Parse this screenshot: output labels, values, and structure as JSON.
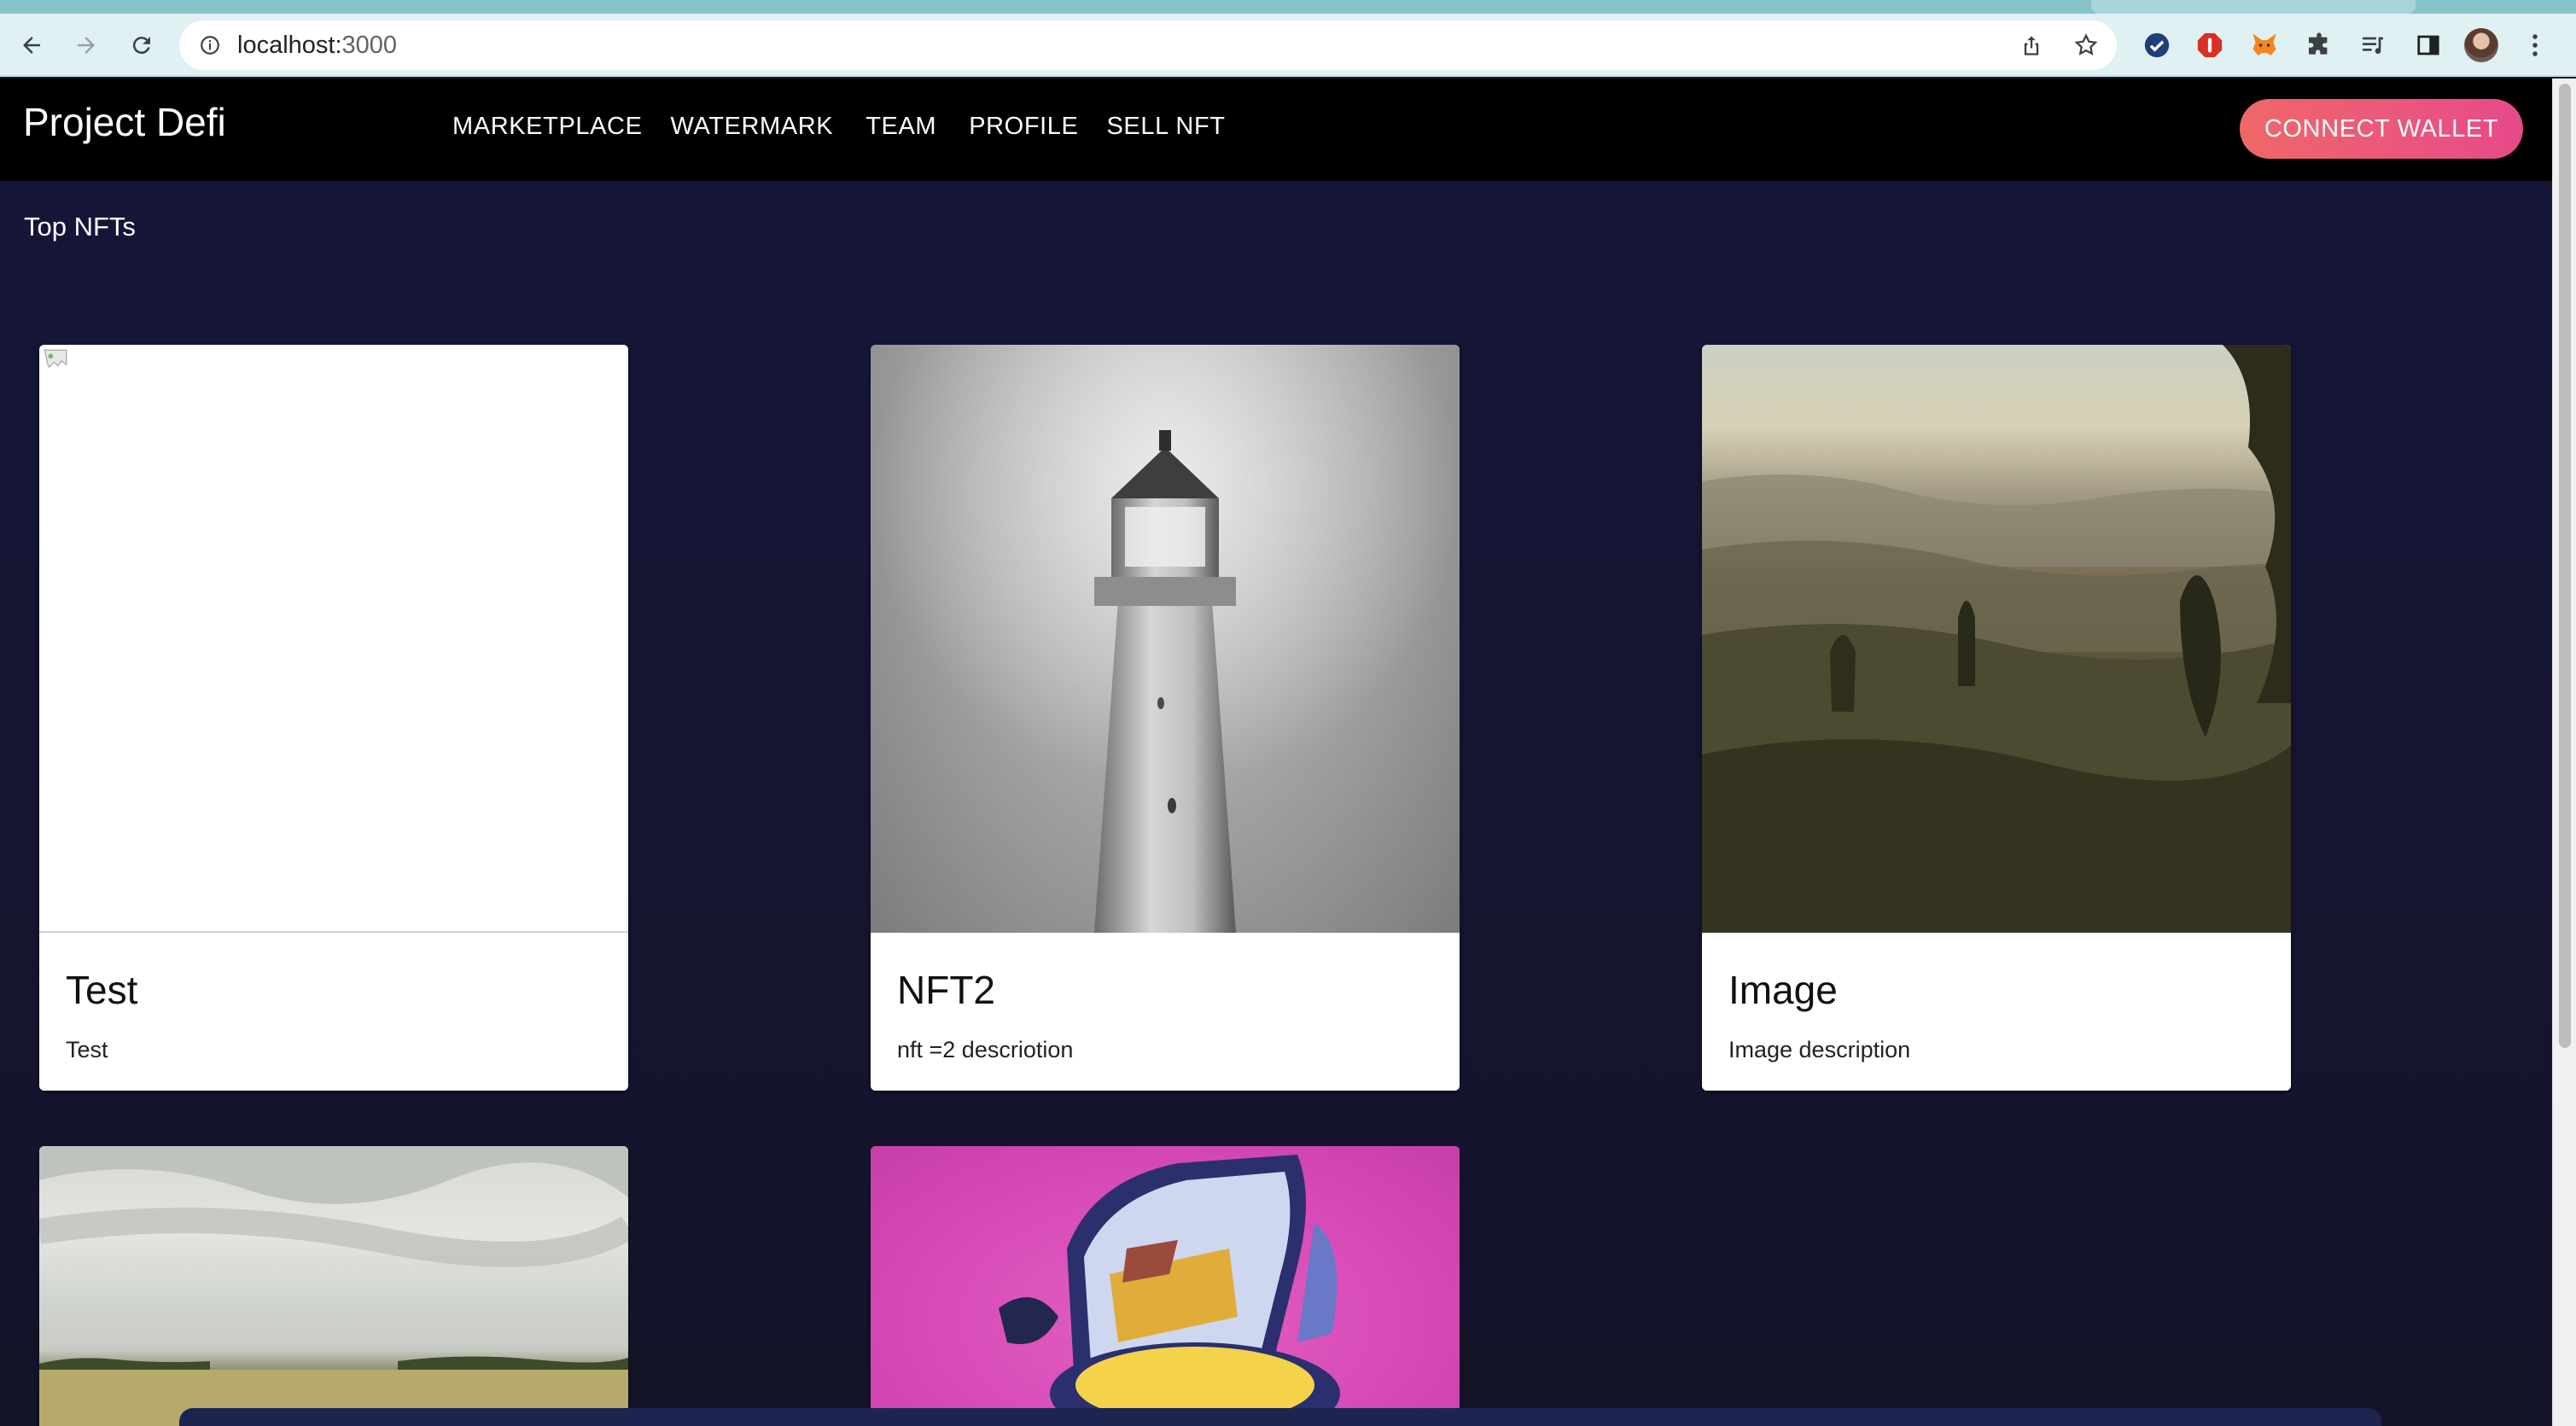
{
  "browser": {
    "url_host": "localhost:",
    "url_port": "3000",
    "icons": [
      "back-arrow-icon",
      "forward-arrow-icon",
      "reload-icon",
      "site-info-icon",
      "share-icon",
      "bookmark-star-icon",
      "check-extension-icon",
      "shield-extension-icon",
      "metamask-fox-icon",
      "puzzle-extensions-icon",
      "media-queue-icon",
      "side-panel-icon",
      "profile-avatar",
      "kebab-menu-icon"
    ]
  },
  "app": {
    "brand": "Project Defi",
    "nav": [
      "MARKETPLACE",
      "WATERMARK",
      "TEAM",
      "PROFILE",
      "SELL NFT"
    ],
    "connect_label": "CONNECT WALLET",
    "accent_gradient": [
      "#ef6868",
      "#e64a8a"
    ],
    "background": "#151532"
  },
  "main": {
    "section_title": "Top NFTs",
    "cards": [
      {
        "title": "Test",
        "description": "Test",
        "image": "broken-image"
      },
      {
        "title": "NFT2",
        "description": "nft =2 descriotion",
        "image": "lighthouse-photo"
      },
      {
        "title": "Image",
        "description": "Image description",
        "image": "hillside-landscape-photo"
      },
      {
        "title": "",
        "description": "",
        "image": "field-sky-photo"
      },
      {
        "title": "",
        "description": "",
        "image": "abstract-chair-art"
      }
    ]
  }
}
